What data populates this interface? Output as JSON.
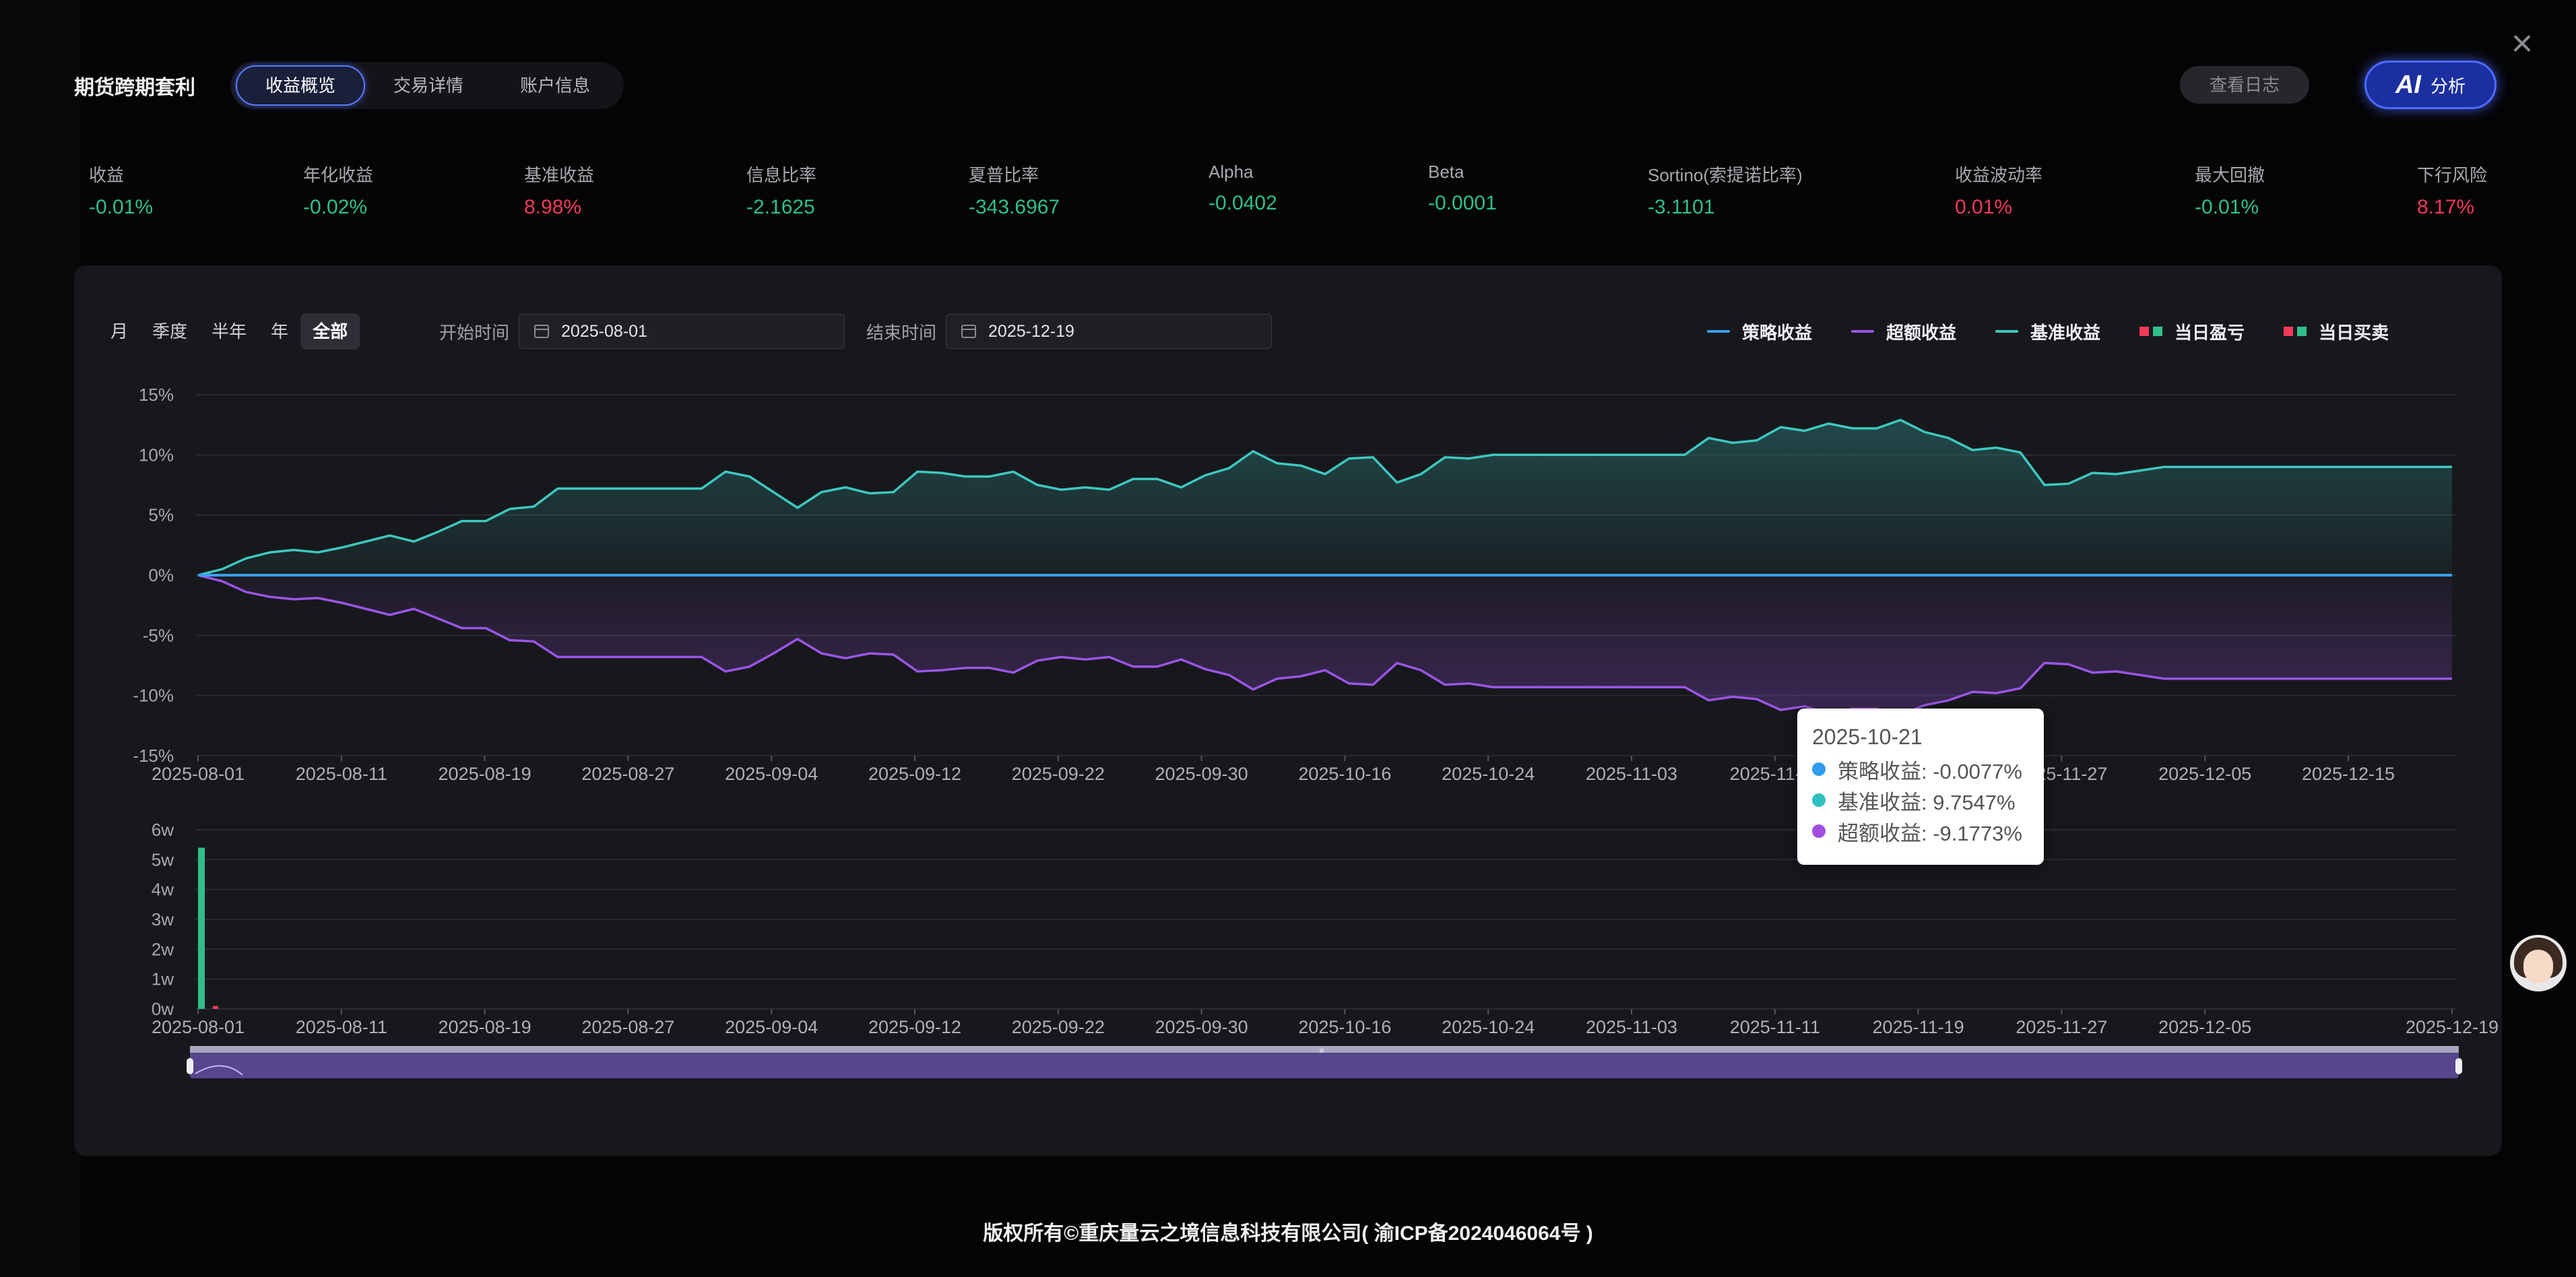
{
  "header": {
    "title": "期货跨期套利",
    "tabs": [
      {
        "label": "收益概览",
        "active": true
      },
      {
        "label": "交易详情",
        "active": false
      },
      {
        "label": "账户信息",
        "active": false
      }
    ],
    "log_button": "查看日志",
    "ai_icon": "AI",
    "ai_button": "分析"
  },
  "metrics": [
    {
      "label": "收益",
      "value": "-0.01%",
      "color": "#2fc08a"
    },
    {
      "label": "年化收益",
      "value": "-0.02%",
      "color": "#2fc08a"
    },
    {
      "label": "基准收益",
      "value": "8.98%",
      "color": "#ef3a5a"
    },
    {
      "label": "信息比率",
      "value": "-2.1625",
      "color": "#2fc08a"
    },
    {
      "label": "夏普比率",
      "value": "-343.6967",
      "color": "#2fc08a"
    },
    {
      "label": "Alpha",
      "value": "-0.0402",
      "color": "#2fc08a"
    },
    {
      "label": "Beta",
      "value": "-0.0001",
      "color": "#2fc08a"
    },
    {
      "label": "Sortino(索提诺比率)",
      "value": "-3.1101",
      "color": "#2fc08a"
    },
    {
      "label": "收益波动率",
      "value": "0.01%",
      "color": "#ef3a5a"
    },
    {
      "label": "最大回撤",
      "value": "-0.01%",
      "color": "#2fc08a"
    },
    {
      "label": "下行风险",
      "value": "8.17%",
      "color": "#ef3a5a"
    }
  ],
  "controls": {
    "periods": [
      {
        "label": "月",
        "active": false
      },
      {
        "label": "季度",
        "active": false
      },
      {
        "label": "半年",
        "active": false
      },
      {
        "label": "年",
        "active": false
      },
      {
        "label": "全部",
        "active": true
      }
    ],
    "start_label": "开始时间",
    "start_date": "2025-08-01",
    "end_label": "结束时间",
    "end_date": "2025-12-19"
  },
  "legend": [
    {
      "label": "策略收益",
      "type": "line",
      "color": "#3aa0f0"
    },
    {
      "label": "超额收益",
      "type": "line",
      "color": "#9b55e6"
    },
    {
      "label": "基准收益",
      "type": "line",
      "color": "#3dc8c0"
    },
    {
      "label": "当日盈亏",
      "type": "squares",
      "colors": [
        "#ef3a5a",
        "#2fc08a"
      ]
    },
    {
      "label": "当日买卖",
      "type": "squares",
      "colors": [
        "#ef3a5a",
        "#2fc08a"
      ]
    }
  ],
  "tooltip": {
    "date": "2025-10-21",
    "rows": [
      {
        "text": "策略收益: -0.0077%",
        "color": "#2f9bf0"
      },
      {
        "text": "基准收益: 9.7547%",
        "color": "#2fbfbf"
      },
      {
        "text": "超额收益: -9.1773%",
        "color": "#a14fe0"
      }
    ]
  },
  "chart_data": [
    {
      "type": "area",
      "ylim": [
        -15,
        15
      ],
      "y_ticks": [
        "15%",
        "10%",
        "5%",
        "0%",
        "-5%",
        "-10%",
        "-15%"
      ],
      "x_ticks": [
        "2025-08-01",
        "2025-08-11",
        "2025-08-19",
        "2025-08-27",
        "2025-09-04",
        "2025-09-12",
        "2025-09-22",
        "2025-09-30",
        "2025-10-16",
        "2025-10-24",
        "2025-11-03",
        "2025-11-11",
        "2025-11-19",
        "2025-11-27",
        "2025-12-05",
        "2025-12-15"
      ],
      "series": [
        {
          "name": "策略收益",
          "color": "#3aa0f0",
          "values": [
            0,
            0
          ]
        },
        {
          "name": "基准收益",
          "color": "#3dc8c0",
          "values": [
            0,
            0.5,
            1.4,
            1.9,
            2.1,
            1.9,
            2.3,
            2.8,
            3.3,
            2.8,
            3.6,
            4.5,
            4.5,
            5.5,
            5.7,
            7.2,
            7.2,
            7.2,
            7.2,
            7.2,
            7.2,
            7.2,
            8.6,
            8.2,
            6.9,
            5.6,
            6.9,
            7.3,
            6.8,
            6.9,
            8.6,
            8.5,
            8.2,
            8.2,
            8.6,
            7.5,
            7.1,
            7.3,
            7.1,
            8.0,
            8.0,
            7.3,
            8.3,
            8.9,
            10.3,
            9.3,
            9.1,
            8.4,
            9.7,
            9.8,
            7.7,
            8.4,
            9.8,
            9.7,
            10.0,
            10.0,
            10.0,
            10.0,
            10.0,
            10.0,
            10.0,
            10.0,
            10.0,
            11.4,
            11.0,
            11.2,
            12.3,
            12.0,
            12.6,
            12.2,
            12.2,
            12.9,
            11.9,
            11.4,
            10.4,
            10.6,
            10.2,
            7.5,
            7.6,
            8.5,
            8.4,
            8.7,
            9.0,
            9.0,
            9.0,
            9.0,
            9.0,
            9.0,
            9.0,
            9.0,
            9.0,
            9.0,
            9.0,
            9.0,
            9.0
          ]
        },
        {
          "name": "超额收益",
          "color": "#9b55e6",
          "values": [
            0,
            -0.5,
            -1.4,
            -1.8,
            -2.0,
            -1.9,
            -2.3,
            -2.8,
            -3.3,
            -2.8,
            -3.6,
            -4.4,
            -4.4,
            -5.4,
            -5.5,
            -6.8,
            -6.8,
            -6.8,
            -6.8,
            -6.8,
            -6.8,
            -6.8,
            -8.0,
            -7.6,
            -6.5,
            -5.3,
            -6.5,
            -6.9,
            -6.5,
            -6.6,
            -8.0,
            -7.9,
            -7.7,
            -7.7,
            -8.1,
            -7.1,
            -6.8,
            -7.0,
            -6.8,
            -7.6,
            -7.6,
            -7.0,
            -7.8,
            -8.3,
            -9.5,
            -8.6,
            -8.4,
            -7.9,
            -9.0,
            -9.1,
            -7.3,
            -7.9,
            -9.1,
            -9.0,
            -9.3,
            -9.3,
            -9.3,
            -9.3,
            -9.3,
            -9.3,
            -9.3,
            -9.3,
            -9.3,
            -10.4,
            -10.1,
            -10.3,
            -11.2,
            -10.9,
            -11.5,
            -11.1,
            -11.1,
            -11.6,
            -10.8,
            -10.4,
            -9.7,
            -9.8,
            -9.4,
            -7.3,
            -7.4,
            -8.1,
            -8.0,
            -8.3,
            -8.6,
            -8.6,
            -8.6,
            -8.6,
            -8.6,
            -8.6,
            -8.6,
            -8.6,
            -8.6,
            -8.6,
            -8.6,
            -8.6,
            -8.6
          ]
        }
      ]
    },
    {
      "type": "bar",
      "ylim": [
        0,
        60000
      ],
      "y_ticks": [
        "6w",
        "5w",
        "4w",
        "3w",
        "2w",
        "1w",
        "0w"
      ],
      "x_ticks": [
        "2025-08-01",
        "2025-08-11",
        "2025-08-19",
        "2025-08-27",
        "2025-09-04",
        "2025-09-12",
        "2025-09-22",
        "2025-09-30",
        "2025-10-16",
        "2025-10-24",
        "2025-11-03",
        "2025-11-11",
        "2025-11-19",
        "2025-11-27",
        "2025-12-05",
        "2025-12-19"
      ],
      "bars": [
        {
          "date": "2025-08-01",
          "value": 54000,
          "color": "#2fc08a"
        },
        {
          "date": "2025-08-04",
          "value": 1000,
          "color": "#ef3a5a"
        }
      ]
    }
  ],
  "footer": "版权所有©重庆量云之境信息科技有限公司( 渝ICP备2024046064号 )"
}
